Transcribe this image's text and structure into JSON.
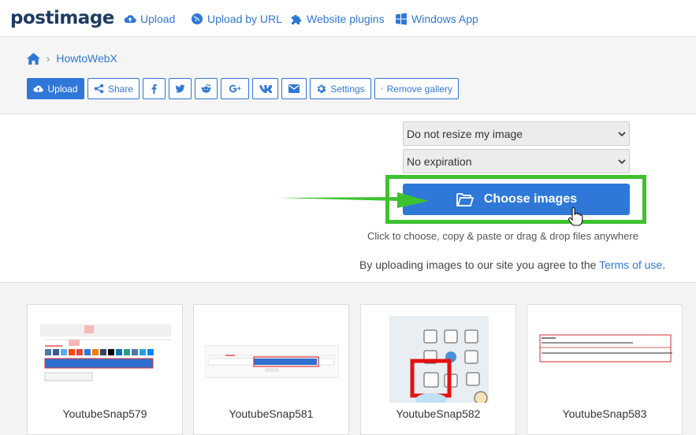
{
  "brand": {
    "logo": "postimage",
    "accent": "#2f78d8",
    "highlight": "#3ec12f"
  },
  "nav": {
    "upload": "Upload",
    "upload_by_url": "Upload by URL",
    "website_plugins": "Website plugins",
    "windows_app": "Windows App"
  },
  "breadcrumb": {
    "home_icon": "home-icon",
    "current": "HowtoWebX"
  },
  "toolbar": {
    "upload": "Upload",
    "share": "Share",
    "settings": "Settings",
    "remove_gallery": "Remove gallery",
    "icons": [
      "facebook-icon",
      "twitter-icon",
      "reddit-icon",
      "google-plus-icon",
      "vk-icon",
      "email-icon"
    ]
  },
  "uploader": {
    "resize_option": "Do not resize my image",
    "expiration_option": "No expiration",
    "choose_button": "Choose images",
    "hint": "Click to choose, copy & paste or drag & drop files anywhere",
    "terms_prefix": "By uploading images to our site you agree to the ",
    "terms_link": "Terms of use",
    "terms_suffix": "."
  },
  "gallery": {
    "items": [
      {
        "caption": "YoutubeSnap579"
      },
      {
        "caption": "YoutubeSnap581"
      },
      {
        "caption": "YoutubeSnap582"
      },
      {
        "caption": "YoutubeSnap583"
      }
    ]
  }
}
